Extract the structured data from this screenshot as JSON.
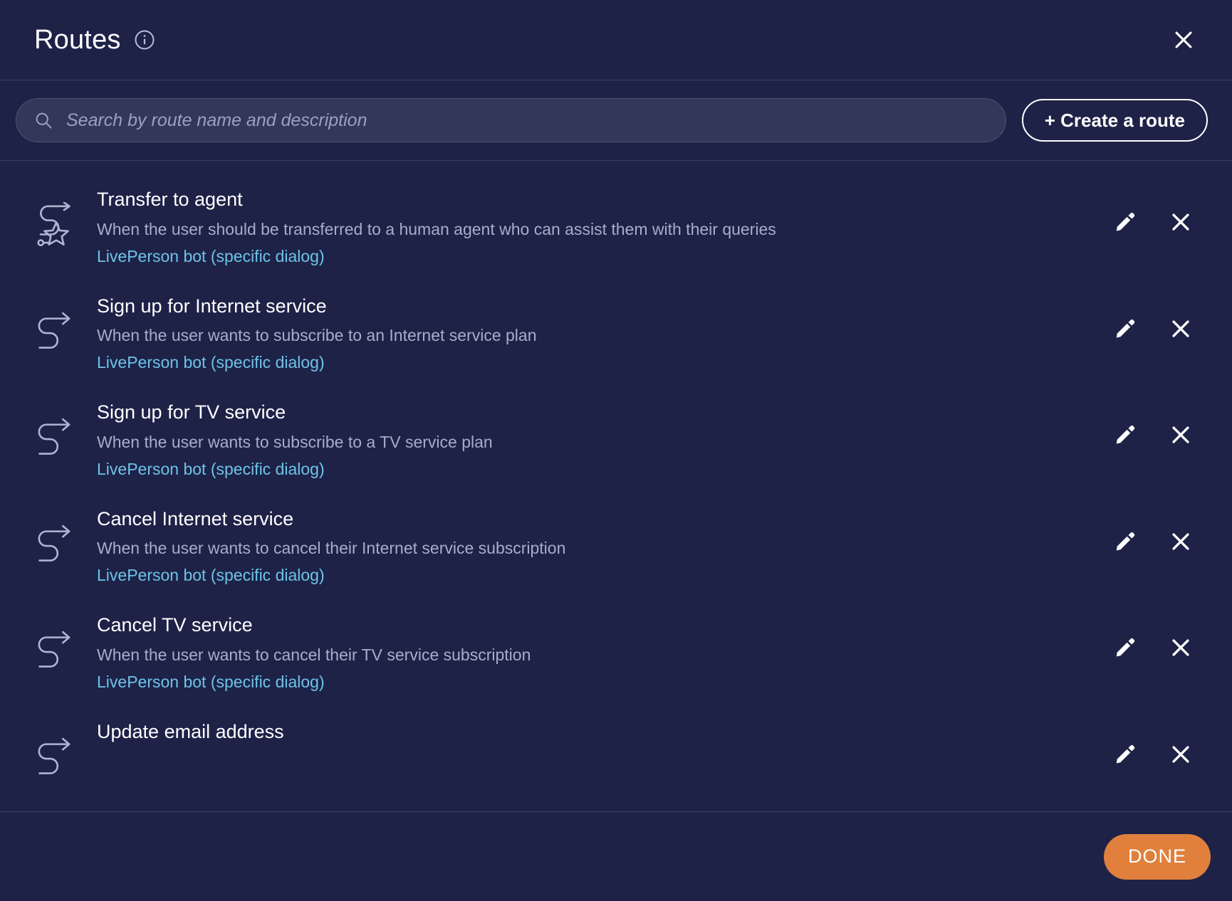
{
  "header": {
    "title": "Routes",
    "info_icon": "info-icon",
    "close_icon": "close-icon"
  },
  "search": {
    "placeholder": "Search by route name and description",
    "value": "",
    "icon": "search-icon"
  },
  "toolbar": {
    "create_label": "+ Create a route"
  },
  "routes": [
    {
      "name": "Transfer to agent",
      "description": "When the user should be transferred to a human agent who can assist them with their queries",
      "link": "LivePerson bot (specific dialog)",
      "icon": "route-star-icon",
      "edit_icon": "pencil-icon",
      "delete_icon": "close-icon"
    },
    {
      "name": "Sign up for Internet service",
      "description": "When the user wants to subscribe to an Internet service plan",
      "link": "LivePerson bot (specific dialog)",
      "icon": "route-icon",
      "edit_icon": "pencil-icon",
      "delete_icon": "close-icon"
    },
    {
      "name": "Sign up for TV service",
      "description": "When the user wants to subscribe to a TV service plan",
      "link": "LivePerson bot (specific dialog)",
      "icon": "route-icon",
      "edit_icon": "pencil-icon",
      "delete_icon": "close-icon"
    },
    {
      "name": "Cancel Internet service",
      "description": "When the user wants to cancel their Internet service subscription",
      "link": "LivePerson bot (specific dialog)",
      "icon": "route-icon",
      "edit_icon": "pencil-icon",
      "delete_icon": "close-icon"
    },
    {
      "name": "Cancel TV service",
      "description": "When the user wants to cancel their TV service subscription",
      "link": "LivePerson bot (specific dialog)",
      "icon": "route-icon",
      "edit_icon": "pencil-icon",
      "delete_icon": "close-icon"
    },
    {
      "name": "Update email address",
      "description": "",
      "link": "",
      "icon": "route-icon",
      "edit_icon": "pencil-icon",
      "delete_icon": "close-icon"
    }
  ],
  "footer": {
    "done_label": "DONE"
  },
  "colors": {
    "background": "#1e2247",
    "accent_orange": "#e0803c",
    "link_blue": "#6ec3e8",
    "text_primary": "#ffffff",
    "text_secondary": "#a8adc8",
    "divider": "#3a3f68",
    "search_field": "#333859"
  }
}
